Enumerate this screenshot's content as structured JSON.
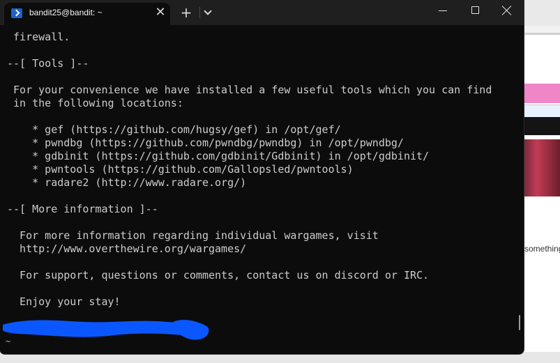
{
  "window": {
    "tab_title": "bandit25@bandit: ~",
    "tab_icon": "powershell-icon",
    "buttons": {
      "close_tab": "✕",
      "new_tab": "+",
      "tab_menu": "chevron-down-icon"
    },
    "controls": {
      "minimize": "minimize-icon",
      "maximize": "maximize-icon",
      "close": "close-icon"
    }
  },
  "terminal": {
    "lines": [
      " firewall.",
      "",
      "--[ Tools ]--",
      "",
      " For your convenience we have installed a few useful tools which you can find",
      " in the following locations:",
      "",
      "    * gef (https://github.com/hugsy/gef) in /opt/gef/",
      "    * pwndbg (https://github.com/pwndbg/pwndbg) in /opt/pwndbg/",
      "    * gdbinit (https://github.com/gdbinit/Gdbinit) in /opt/gdbinit/",
      "    * pwntools (https://github.com/Gallopsled/pwntools)",
      "    * radare2 (http://www.radare.org/)",
      "",
      "--[ More information ]--",
      "",
      "  For more information regarding individual wargames, visit",
      "  http://www.overthewire.org/wargames/",
      "",
      "  For support, questions or comments, contact us on discord or IRC.",
      "",
      "  Enjoy your stay!"
    ],
    "prompt_tail": "~"
  },
  "background": {
    "right_snippet": "something"
  },
  "colors": {
    "terminal_bg": "#0c0c0c",
    "text": "#cccccc",
    "redaction": "#0b57ff"
  }
}
